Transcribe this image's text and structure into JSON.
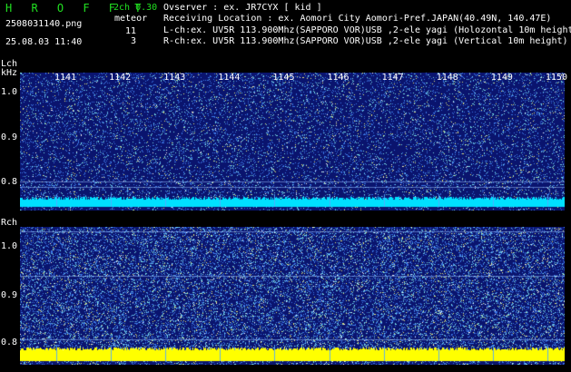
{
  "header": {
    "brand": "H R O F F T",
    "version": "2ch 0.30",
    "filename": "2508031140.png",
    "meteor_label": "meteor",
    "meteor_count_l": "11",
    "meteor_count_r": "3",
    "datetime": "25.08.03 11:40",
    "observer": "Ovserver           : ex. JR7CYX [ kid ]",
    "location": "Receiving Location : ex. Aomori City Aomori-Pref.JAPAN(40.49N, 140.47E)",
    "lch_info": "L-ch:ex. UV5R 113.900Mhz(SAPPORO VOR)USB ,2-ele yagi (Holozontal 10m height)",
    "rch_info": "R-ch:ex. UV5R 113.900Mhz(SAPPORO VOR)USB ,2-ele yagi (Vertical 10m height)"
  },
  "lch": {
    "label_line1": "Lch",
    "label_line2": "kHz",
    "y_labels": [
      "1.0",
      "0.9",
      "0.8"
    ]
  },
  "rch": {
    "label": "Rch",
    "y_labels": [
      "1.0",
      "0.9",
      "0.8"
    ]
  },
  "time_ticks": [
    "1141",
    "1142",
    "1143",
    "1144",
    "1145",
    "1146",
    "1147",
    "1148",
    "1149",
    "1150"
  ],
  "colors": {
    "waterfall_bg": "#1a2a8a",
    "lch_baseline": "#00e0ff",
    "rch_baseline": "#ffff00",
    "text_green": "#21e021"
  }
}
